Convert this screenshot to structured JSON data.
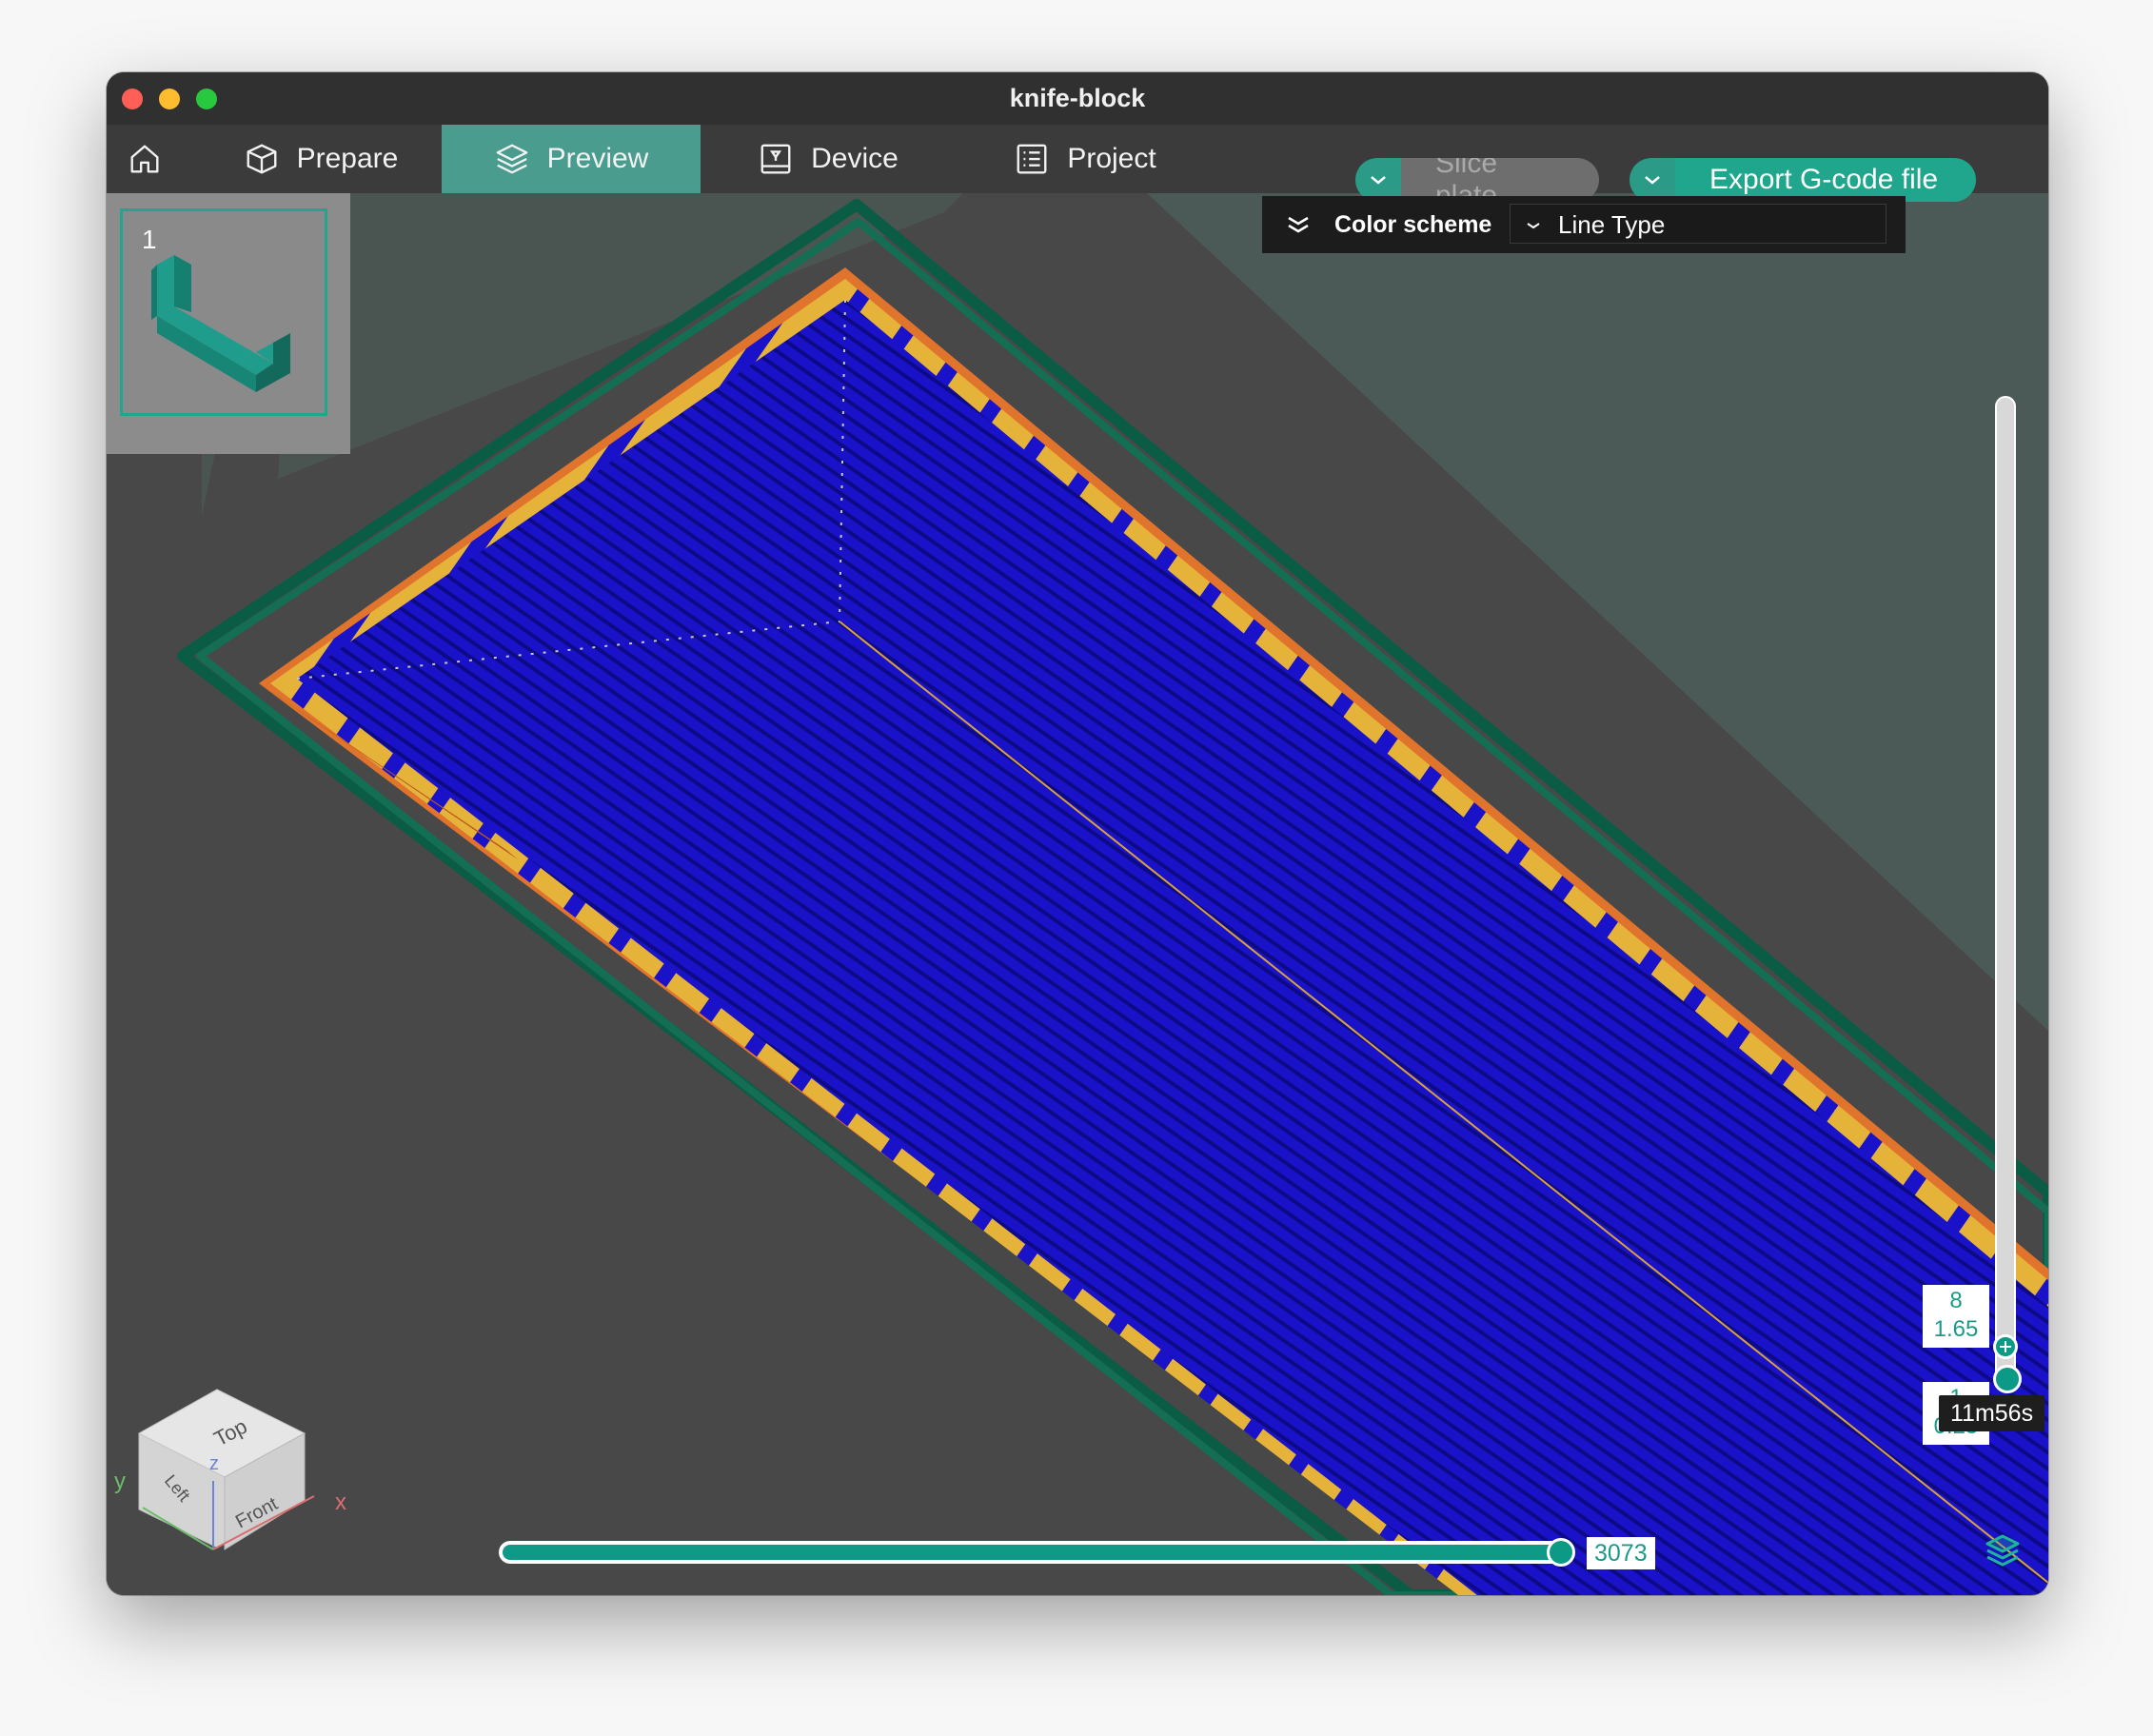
{
  "window": {
    "title": "knife-block"
  },
  "tabs": [
    {
      "label": "",
      "icon": "home-icon"
    },
    {
      "label": "Prepare",
      "icon": "cube-icon"
    },
    {
      "label": "Preview",
      "icon": "layers-icon"
    },
    {
      "label": "Device",
      "icon": "device-icon"
    },
    {
      "label": "Project",
      "icon": "list-icon"
    }
  ],
  "toolbar": {
    "slice_label": "Slice plate",
    "export_label": "Export G-code file"
  },
  "plates": [
    {
      "number": "1"
    }
  ],
  "color_scheme": {
    "label": "Color scheme",
    "value": "Line Type"
  },
  "layer_slider": {
    "top_layer": "8",
    "top_height": "1.65",
    "bottom_layer": "1",
    "bottom_height": "0.25",
    "time": "11m56s"
  },
  "move_slider": {
    "value": "3073",
    "progress": 1.0
  },
  "axis_cube": {
    "faces": [
      "Top",
      "Left",
      "Front"
    ],
    "axes": [
      "x",
      "y",
      "z"
    ]
  },
  "colors": {
    "accent": "#0c9a86",
    "tab_active": "#4a9c8f",
    "infill": "#1a12c8",
    "outer_wall": "#e5b23a",
    "inner_wall": "#e0742c",
    "skirt": "#0f6a4f",
    "background": "#484848"
  }
}
